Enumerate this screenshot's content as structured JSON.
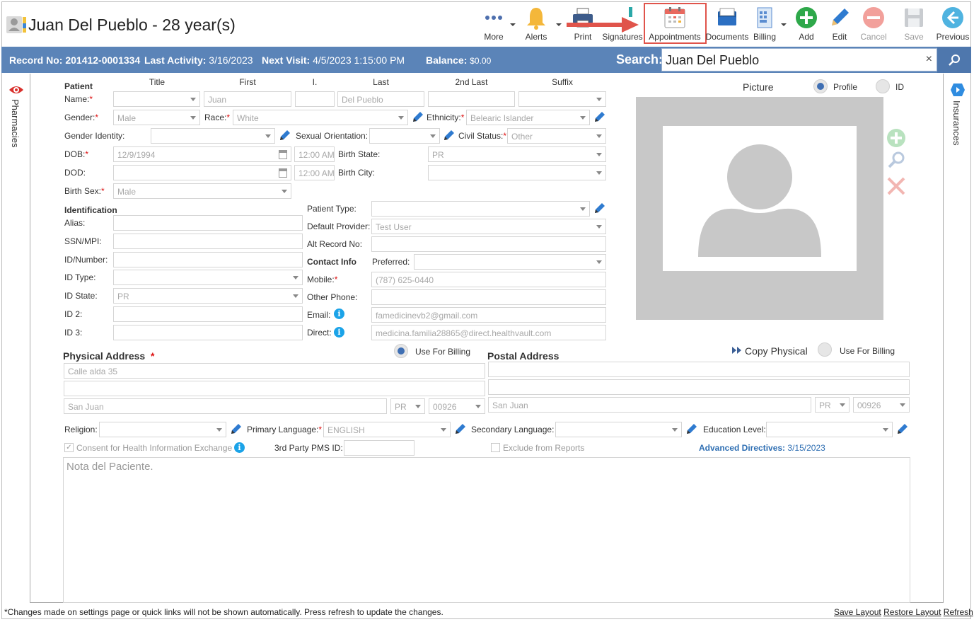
{
  "header": {
    "patient_title": "Juan Del Pueblo - 28 year(s)"
  },
  "toolbar": {
    "more": "More",
    "alerts": "Alerts",
    "print": "Print",
    "signatures": "Signatures",
    "appointments": "Appointments",
    "documents": "Documents",
    "billing": "Billing",
    "add": "Add",
    "edit": "Edit",
    "cancel": "Cancel",
    "save": "Save",
    "previous": "Previous"
  },
  "infobar": {
    "record_label": "Record No:",
    "record_value": "201412-0001334",
    "activity_label": "Last Activity:",
    "activity_value": "3/16/2023",
    "visit_label": "Next Visit:",
    "visit_value": "4/5/2023 1:15:00 PM",
    "balance_label": "Balance:",
    "balance_value": "$0.00",
    "search_label": "Search:",
    "search_value": "Juan Del Pueblo",
    "clear": "×"
  },
  "side": {
    "left_tab": "Pharmacies",
    "right_tab": "Insurances"
  },
  "patient": {
    "section": "Patient",
    "col_title": "Title",
    "col_first": "First",
    "col_initial": "I.",
    "col_last": "Last",
    "col_2nd_last": "2nd Last",
    "col_suffix": "Suffix",
    "name_label": "Name:",
    "first": "Juan",
    "last": "Del Pueblo",
    "gender_label": "Gender:",
    "gender": "Male",
    "race_label": "Race:",
    "race": "White",
    "ethnicity_label": "Ethnicity:",
    "ethnicity": "Belearic Islander",
    "gender_identity_label": "Gender Identity:",
    "sexual_orientation_label": "Sexual Orientation:",
    "civil_status_label": "Civil Status:",
    "civil_status": "Other",
    "dob_label": "DOB:",
    "dob": "12/9/1994",
    "dob_time": "12:00 AM",
    "birth_state_label": "Birth State:",
    "birth_state": "PR",
    "dod_label": "DOD:",
    "dod_time": "12:00 AM",
    "birth_city_label": "Birth City:",
    "birth_sex_label": "Birth Sex:",
    "birth_sex": "Male",
    "required_mark": "*"
  },
  "identification": {
    "section": "Identification",
    "alias": "Alias:",
    "ssn": "SSN/MPI:",
    "id_number": "ID/Number:",
    "id_type": "ID Type:",
    "id_state": "ID State:",
    "id_state_value": "PR",
    "id2": "ID 2:",
    "id3": "ID 3:"
  },
  "details": {
    "patient_type": "Patient Type:",
    "default_provider": "Default Provider:",
    "default_provider_value": "Test User",
    "alt_record": "Alt Record No:",
    "contact_info": "Contact Info",
    "preferred": "Preferred:",
    "mobile": "Mobile:",
    "mobile_value": "(787) 625-0440",
    "other_phone": "Other Phone:",
    "email": "Email:",
    "email_value": "famedicinevb2@gmail.com",
    "direct": "Direct:",
    "direct_value": "medicina.familia28865@direct.healthvault.com",
    "info_glyph": "i"
  },
  "picture": {
    "title": "Picture",
    "profile": "Profile",
    "id": "ID"
  },
  "physical": {
    "title": "Physical Address",
    "use_billing": "Use For Billing",
    "line1": "Calle alda 35",
    "city": "San Juan",
    "state": "PR",
    "zip": "00926"
  },
  "postal": {
    "title": "Postal Address",
    "copy": "Copy Physical",
    "use_billing": "Use For Billing",
    "city": "San Juan",
    "state": "PR",
    "zip": "00926"
  },
  "bottom": {
    "religion": "Religion:",
    "primary_language": "Primary Language:",
    "primary_language_value": "ENGLISH",
    "secondary_language": "Secondary Language:",
    "education": "Education Level:",
    "consent": "Consent for Health Information Exchange",
    "pms_id": "3rd Party PMS ID:",
    "exclude": "Exclude from Reports",
    "advanced_label": "Advanced Directives:",
    "advanced_value": "3/15/2023",
    "note_placeholder": "Nota del Paciente.",
    "check_glyph": "✓"
  },
  "footer": {
    "notice": "*Changes made on settings page or quick links will not be shown automatically. Press refresh to update the changes.",
    "save_layout": "Save Layout",
    "restore_layout": "Restore Layout",
    "refresh": "Refresh"
  },
  "colors": {
    "bar": "#5b84b8",
    "accent_red": "#e0544b",
    "info_blue": "#1ba3e8"
  }
}
